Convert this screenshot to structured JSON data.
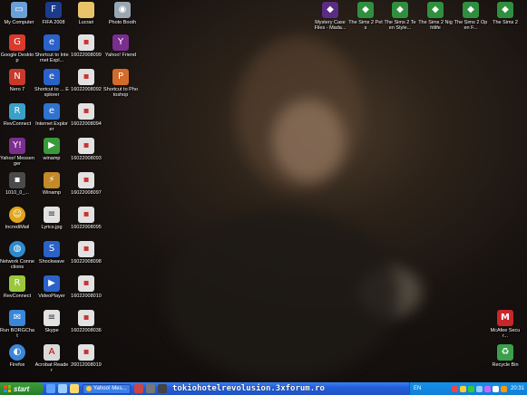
{
  "desktop": {
    "icons": [
      {
        "label": "My Computer",
        "icon": "computer-icon",
        "color": "#6aa0d8"
      },
      {
        "label": "FIFA 2008",
        "icon": "fifa-icon",
        "color": "#1b3c8c"
      },
      {
        "label": "Lucrari",
        "icon": "folder-icon",
        "color": "#e8c36a"
      },
      {
        "label": "Photo Booth",
        "icon": "photo-booth-icon",
        "color": "#9aa7b3"
      },
      {
        "label": "Mystery Case Files - Mada...",
        "icon": "game-icon",
        "color": "#5b2c83"
      },
      {
        "label": "The Sims 2 Pets",
        "icon": "sims-icon",
        "color": "#2f8f3e"
      },
      {
        "label": "The Sims 2 Teen Style...",
        "icon": "sims-icon",
        "color": "#2f8f3e"
      },
      {
        "label": "The Sims 2 Nightlife",
        "icon": "sims-icon",
        "color": "#2f8f3e"
      },
      {
        "label": "The Sims 2 Open F...",
        "icon": "sims-icon",
        "color": "#2f8f3e"
      },
      {
        "label": "The Sims 2",
        "icon": "sims-icon",
        "color": "#2f8f3e"
      },
      {
        "label": "Google Desktop",
        "icon": "google-desktop-icon",
        "color": "#d93a2b"
      },
      {
        "label": "Shortcut to Internet Expl...",
        "icon": "shortcut-icon",
        "color": "#2a62c9"
      },
      {
        "label": "16022008099",
        "icon": "image-file-icon",
        "color": "#e2e2e2"
      },
      {
        "label": "Yahoo! Friend",
        "icon": "yahoo-friend-icon",
        "color": "#7a2e8e"
      },
      {
        "label": "Nero 7",
        "icon": "nero-icon",
        "color": "#c7392b"
      },
      {
        "label": "Shortcut to ... Explorer",
        "icon": "shortcut-icon",
        "color": "#2a62c9"
      },
      {
        "label": "16022008092",
        "icon": "image-file-icon",
        "color": "#e2e2e2"
      },
      {
        "label": "Shortcut to Photoshop",
        "icon": "photoshop-icon",
        "color": "#d56b2a"
      },
      {
        "label": "RevConnect",
        "icon": "revconnect-icon",
        "color": "#3aa0c8"
      },
      {
        "label": "Internet Explorer",
        "icon": "ie-icon",
        "color": "#2f73d1"
      },
      {
        "label": "16022008094",
        "icon": "image-file-icon",
        "color": "#e2e2e2"
      },
      {
        "label": "Yahoo! Messenger",
        "icon": "yahoo-messenger-icon",
        "color": "#7a2e8e"
      },
      {
        "label": "winamp",
        "icon": "winamp-icon",
        "color": "#3a9a3a"
      },
      {
        "label": "16022008093",
        "icon": "image-file-icon",
        "color": "#e2e2e2"
      },
      {
        "label": "1010_0_...",
        "icon": "image-file-icon",
        "color": "#4a4a4a"
      },
      {
        "label": "Winamp",
        "icon": "winamp-icon",
        "color": "#c48a2a"
      },
      {
        "label": "16022008097",
        "icon": "image-file-icon",
        "color": "#e2e2e2"
      },
      {
        "label": "IncrediMail",
        "icon": "smiley-icon",
        "color": "#e0a51c"
      },
      {
        "label": "Lyrics.jpg",
        "icon": "document-icon",
        "color": "#e2e2e2"
      },
      {
        "label": "16022008095",
        "icon": "image-file-icon",
        "color": "#e2e2e2"
      },
      {
        "label": "Network Connections",
        "icon": "network-icon",
        "color": "#2f8acb"
      },
      {
        "label": "Shockwave",
        "icon": "shockwave-icon",
        "color": "#2a62c9"
      },
      {
        "label": "16022008098",
        "icon": "image-file-icon",
        "color": "#e2e2e2"
      },
      {
        "label": "RevConnect",
        "icon": "revconnect-icon",
        "color": "#9ac83a"
      },
      {
        "label": "VideoPlayer",
        "icon": "media-player-icon",
        "color": "#2a62c9"
      },
      {
        "label": "16022008010",
        "icon": "image-file-icon",
        "color": "#e2e2e2"
      },
      {
        "label": "Run BORGChat",
        "icon": "chat-icon",
        "color": "#3a86d8"
      },
      {
        "label": "Skype",
        "icon": "document-icon",
        "color": "#e2e2e2"
      },
      {
        "label": "16022008036",
        "icon": "image-file-icon",
        "color": "#e2e2e2"
      },
      {
        "label": "Firefox",
        "icon": "firefox-icon",
        "color": "#3a86d8"
      },
      {
        "label": "Acrobat Reader",
        "icon": "acrobat-icon",
        "color": "#d9d9d9"
      },
      {
        "label": "26012008019",
        "icon": "image-file-icon",
        "color": "#e2e2e2"
      },
      {
        "label": "McAfee Secur...",
        "icon": "mcafee-icon",
        "color": "#c8272a"
      },
      {
        "label": "Recycle Bin",
        "icon": "recycle-bin-icon",
        "color": "#3aa04a"
      }
    ]
  },
  "taskbar": {
    "start_label": "start",
    "task_label": "Yahoo! Mes...",
    "url_text": "tokiohotelrevolusion.3xforum.ro",
    "language": "EN",
    "clock": "20:31"
  }
}
